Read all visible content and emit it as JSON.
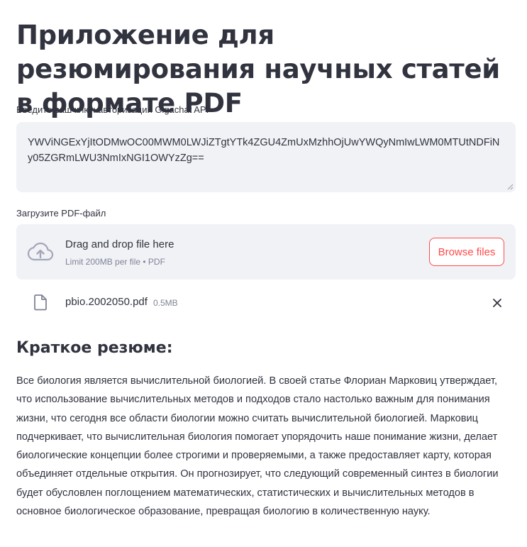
{
  "header": {
    "title": "Приложение для резюмирования научных статей в формате PDF"
  },
  "api_key": {
    "label": "Введите ваш ключ авторизации Gigachat API",
    "value": "YWViNGExYjItODMwOC00MWM0LWJiZTgtYTk4ZGU4ZmUxMzhhOjUwYWQyNmIwLWM0MTUtNDFiNy05ZGRmLWU3NmIxNGI1OWYzZg=="
  },
  "uploader": {
    "label": "Загрузите PDF-файл",
    "drop_title": "Drag and drop file here",
    "drop_limits": "Limit 200MB per file • PDF",
    "browse_label": "Browse files",
    "accent_color": "#ff4b4b",
    "icons": {
      "upload": "cloud-upload-icon",
      "file": "file-icon",
      "remove": "close-icon"
    }
  },
  "uploaded_file": {
    "name": "pbio.2002050.pdf",
    "size": "0.5MB"
  },
  "summary": {
    "heading": "Краткое резюме:",
    "text": "Все биология является вычислительной биологией. В своей статье Флориан Марковиц утверждает, что использование вычислительных методов и подходов стало настолько важным для понимания жизни, что сегодня все области биологии можно считать вычислительной биологией. Марковиц подчеркивает, что вычислительная биология помогает упорядочить наше понимание жизни, делает биологические концепции более строгими и проверяемыми, а также предоставляет карту, которая объединяет отдельные открытия. Он прогнозирует, что следующий современный синтез в биологии будет обусловлен поглощением математических, статистических и вычислительных методов в основное биологическое образование, превращая биологию в количественную науку."
  }
}
